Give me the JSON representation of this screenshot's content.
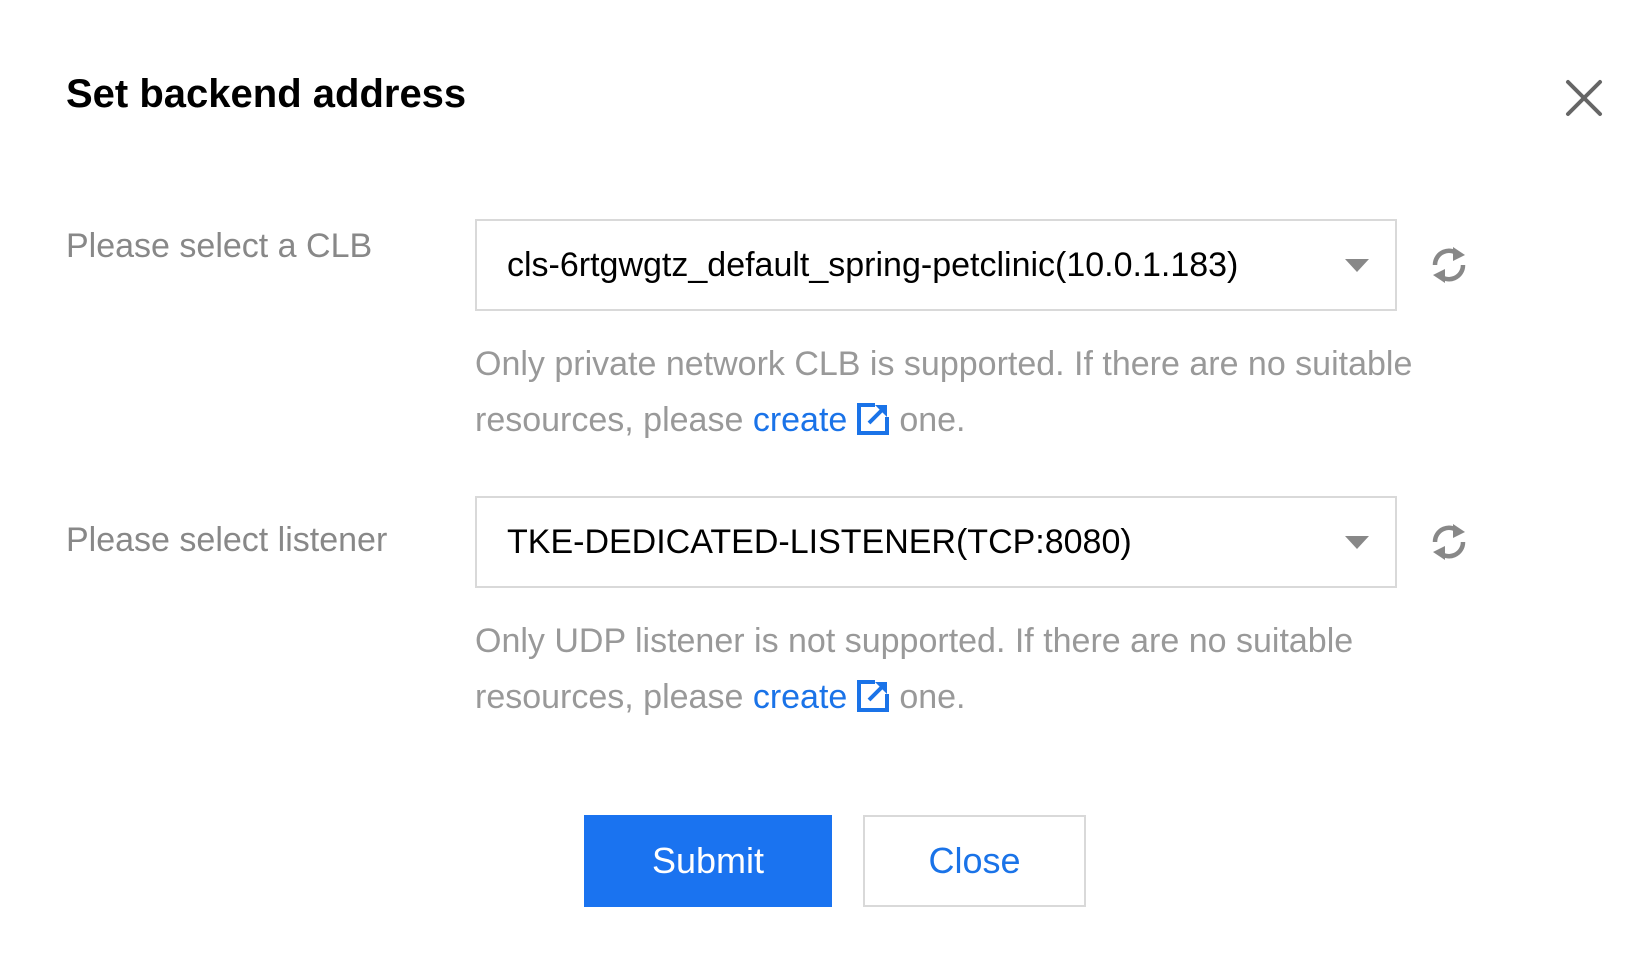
{
  "dialog": {
    "title": "Set backend address",
    "close_icon": "close-icon"
  },
  "clb": {
    "label": "Please select a CLB",
    "selected_value": "cls-6rtgwgtz_default_spring-petclinic(10.0.1.183)",
    "hint_text": "Only private network CLB is supported. If there are no suitable resources, please",
    "hint_link": "create",
    "hint_suffix": "one."
  },
  "listener": {
    "label": "Please select listener",
    "selected_value": "TKE-DEDICATED-LISTENER(TCP:8080)",
    "hint_text": "Only UDP listener is not supported. If there are no suitable resources, please",
    "hint_link": "create",
    "hint_suffix": "one."
  },
  "footer": {
    "submit_label": "Submit",
    "close_label": "Close"
  },
  "colors": {
    "primary": "#1a73f0",
    "link": "#1a73e8",
    "muted_text": "#999999",
    "border": "#d9d9d9"
  }
}
